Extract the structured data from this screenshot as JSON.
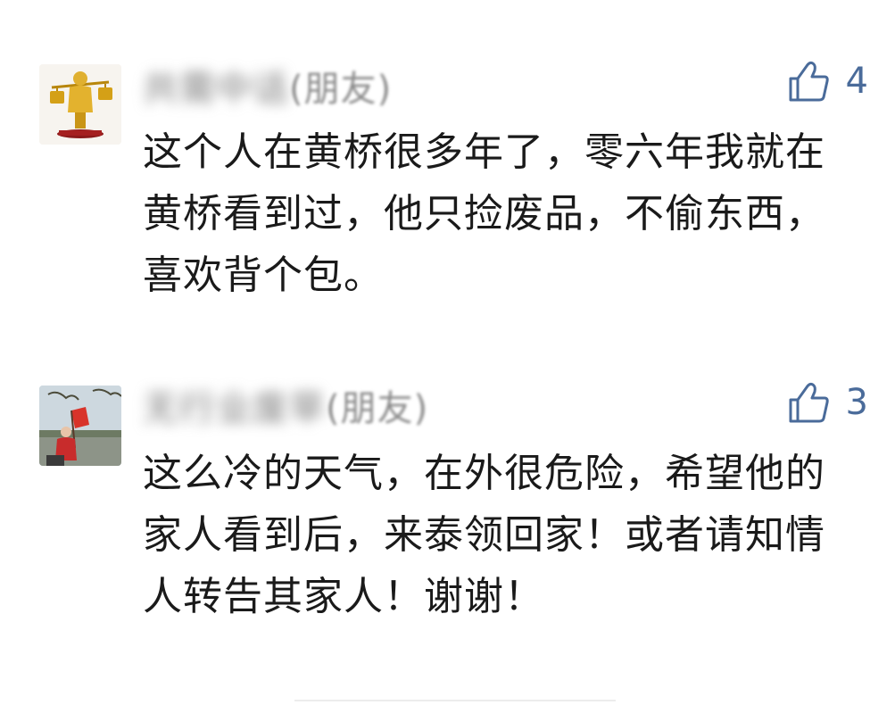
{
  "comments": [
    {
      "nickname": "共需中话",
      "nickname_tag": "(朋友)",
      "likes": "4",
      "avatar": "golden-figurine-avatar",
      "text": "这个人在黄桥很多年了，零六年我就在黄桥看到过，他只捡废品，不偷东西，喜欢背个包。"
    },
    {
      "nickname": "无行业废旱",
      "nickname_tag": "(朋友)",
      "likes": "3",
      "avatar": "outdoor-photo-avatar",
      "text": "这么冷的天气，在外很危险，希望他的家人看到后，来泰领回家！或者请知情人转告其家人！谢谢！"
    }
  ],
  "colors": {
    "like_blue": "#4a6b9a",
    "text": "#1a1a1a",
    "nickname": "#8a8a8a"
  }
}
